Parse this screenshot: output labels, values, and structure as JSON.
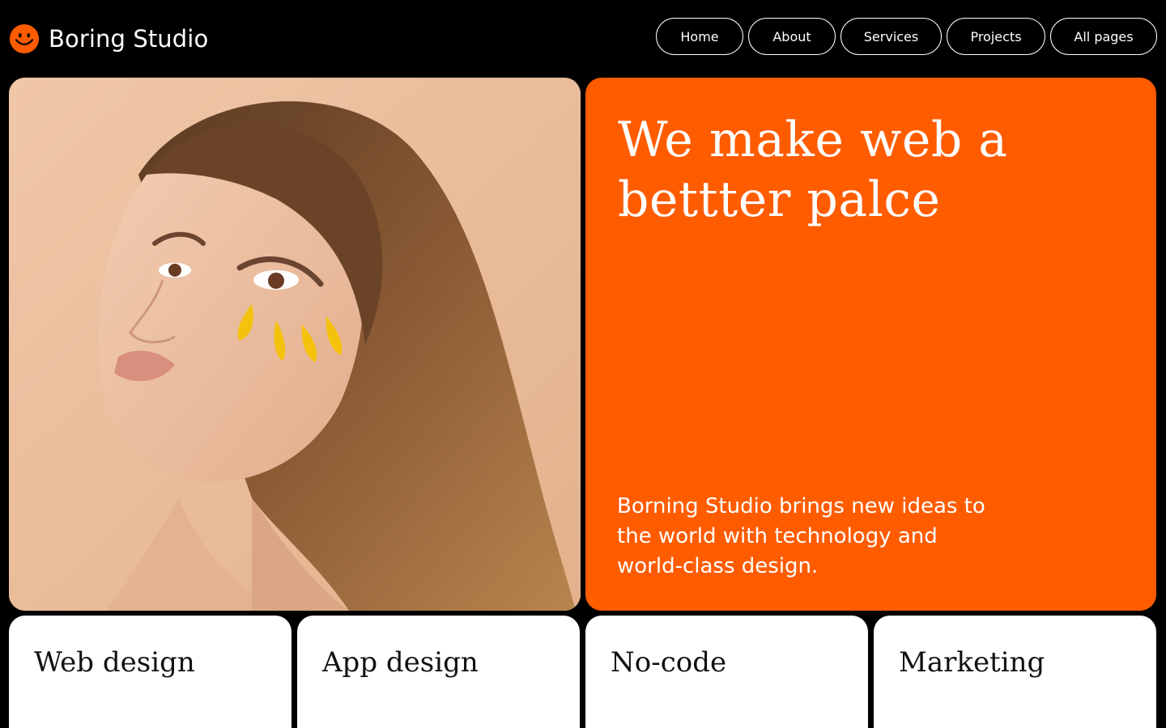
{
  "header": {
    "brand_name": "Boring Studio",
    "logo_icon": "smiley-face-icon",
    "nav": [
      {
        "label": "Home"
      },
      {
        "label": "About"
      },
      {
        "label": "Services"
      },
      {
        "label": "Projects"
      },
      {
        "label": "All pages"
      }
    ]
  },
  "hero": {
    "headline": "We make web a bettter palce",
    "description": "Borning Studio brings new ideas to the world with technology and world-class design.",
    "image_subject": "portrait-photo"
  },
  "services": [
    {
      "title": "Web design"
    },
    {
      "title": "App design"
    },
    {
      "title": "No-code"
    },
    {
      "title": "Marketing"
    }
  ],
  "colors": {
    "background": "#000000",
    "accent": "#ff5c00",
    "card": "#ffffff",
    "text_on_accent": "#ffffff"
  }
}
